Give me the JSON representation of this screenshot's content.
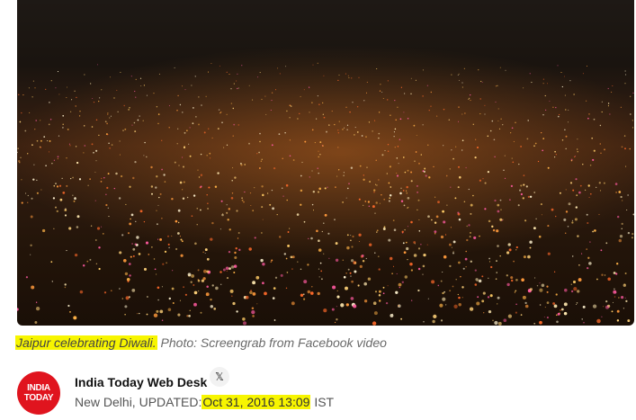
{
  "photo": {
    "alt_icon": "city-night-lights-photo"
  },
  "caption": {
    "highlighted": "Jaipur celebrating Diwali.",
    "rest": " Photo: Screengrab from Facebook video"
  },
  "author": {
    "logo_line1": "INDIA",
    "logo_line2": "TODAY",
    "name": "India Today Web Desk",
    "social_icon": "x-icon",
    "social_glyph": "𝕏"
  },
  "meta": {
    "location": "New Delhi,",
    "updated_label": "UPDATED:",
    "date": "Oct 31, 2016 13:09",
    "tz": "IST"
  },
  "colors": {
    "highlight": "#f7f500",
    "logo_red": "#e0141e"
  }
}
